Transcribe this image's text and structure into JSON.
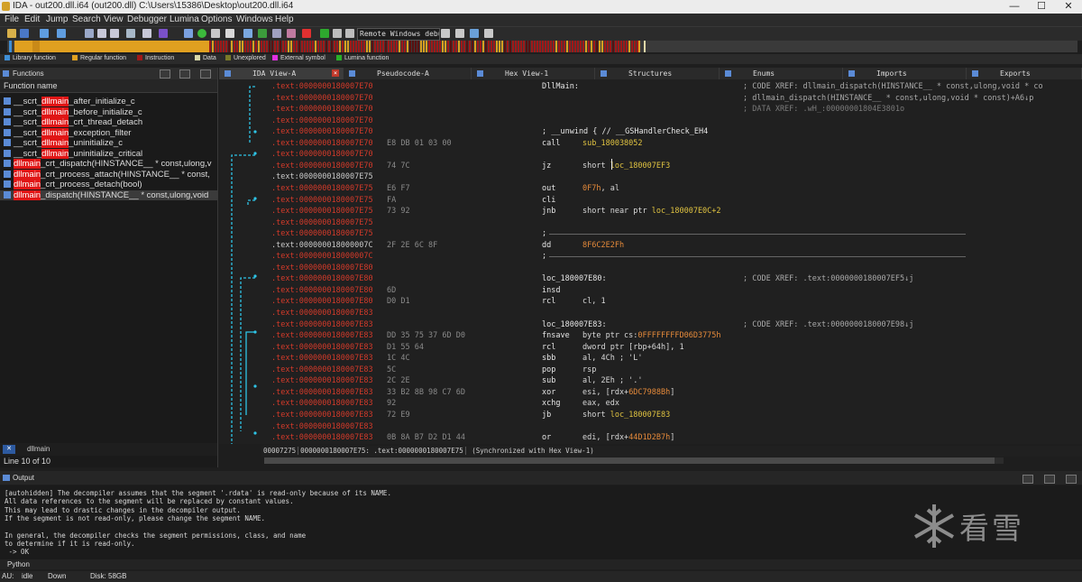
{
  "window": {
    "title": "IDA - out200.dll.i64 (out200.dll) C:\\Users\\15386\\Desktop\\out200.dll.i64",
    "minimize": "—",
    "maximize": "☐",
    "close": "✕"
  },
  "menu": [
    "File",
    "Edit",
    "Jump",
    "Search",
    "View",
    "Debugger",
    "Lumina",
    "Options",
    "Windows",
    "Help"
  ],
  "toolbar": {
    "debugger": "Remote Windows debugger"
  },
  "legend": [
    {
      "label": "Library function",
      "color": "#3f8fd6"
    },
    {
      "label": "Regular function",
      "color": "#e0a020"
    },
    {
      "label": "Instruction",
      "color": "#a01818"
    },
    {
      "label": "Data",
      "color": "#d8d8a8"
    },
    {
      "label": "Unexplored",
      "color": "#7a7a28"
    },
    {
      "label": "External symbol",
      "color": "#e030e0"
    },
    {
      "label": "Lumina function",
      "color": "#28b028"
    }
  ],
  "functions_panel": {
    "title": "Functions",
    "column": "Function name",
    "rows": [
      {
        "pre": "__scrt_",
        "hl": "dllmain",
        "post": "_after_initialize_c",
        "sel": false
      },
      {
        "pre": "__scrt_",
        "hl": "dllmain",
        "post": "_before_initialize_c",
        "sel": false
      },
      {
        "pre": "__scrt_",
        "hl": "dllmain",
        "post": "_crt_thread_detach",
        "sel": false
      },
      {
        "pre": "__scrt_",
        "hl": "dllmain",
        "post": "_exception_filter",
        "sel": false
      },
      {
        "pre": "__scrt_",
        "hl": "dllmain",
        "post": "_uninitialize_c",
        "sel": false
      },
      {
        "pre": "__scrt_",
        "hl": "dllmain",
        "post": "_uninitialize_critical",
        "sel": false
      },
      {
        "pre": "",
        "hl": "dllmain",
        "post": "_crt_dispatch(HINSTANCE__ * const,ulong,v",
        "sel": false
      },
      {
        "pre": "",
        "hl": "dllmain",
        "post": "_crt_process_attach(HINSTANCE__ * const,",
        "sel": false
      },
      {
        "pre": "",
        "hl": "dllmain",
        "post": "_crt_process_detach(bool)",
        "sel": false
      },
      {
        "pre": "",
        "hl": "dllmain",
        "post": "_dispatch(HINSTANCE__ * const,ulong,void",
        "sel": true
      }
    ],
    "search": "dllmain",
    "line_info": "Line 10 of 10"
  },
  "tabs": [
    {
      "label": "IDA View-A",
      "active": true
    },
    {
      "label": "Pseudocode-A",
      "active": false
    },
    {
      "label": "Hex View-1",
      "active": false
    },
    {
      "label": "Structures",
      "active": false
    },
    {
      "label": "Enums",
      "active": false
    },
    {
      "label": "Imports",
      "active": false
    },
    {
      "label": "Exports",
      "active": false
    }
  ],
  "disasm": [
    {
      "addr": ".text:0000000180007E70",
      "bytes": "",
      "ins": "DllMain:",
      "ops": "",
      "cmt": "; CODE XREF: dllmain_dispatch(HINSTANCE__ * const,ulong,void * co",
      "dim": true
    },
    {
      "addr": ".text:0000000180007E70",
      "bytes": "",
      "ins": "",
      "ops": "",
      "cmt": "; dllmain_dispatch(HINSTANCE__ * const,ulong,void * const)+A6↓p",
      "dim": true
    },
    {
      "addr": ".text:0000000180007E70",
      "bytes": "",
      "ins": "",
      "ops": "",
      "cmt": "; DATA XREF: .wH_:00000001804E3801o",
      "dim": true,
      "cmtdim": true
    },
    {
      "addr": ".text:0000000180007E70",
      "bytes": "",
      "ins": "",
      "ops": "",
      "cmt": "",
      "dim": true
    },
    {
      "addr": ".text:0000000180007E70",
      "bytes": "",
      "ins": "; __unwind { // __GSHandlerCheck_EH4",
      "ops": "",
      "cmt": "",
      "dim": true
    },
    {
      "addr": ".text:0000000180007E70",
      "bytes": "E8 DB 01 03 00",
      "ins": "call",
      "ops": "sub_180038052",
      "opsc": "y",
      "cmt": "",
      "dim": true
    },
    {
      "addr": ".text:0000000180007E70",
      "bytes": "",
      "ins": "",
      "ops": "",
      "cmt": "",
      "dim": true
    },
    {
      "addr": ".text:0000000180007E70",
      "bytes": "74 7C",
      "ins": "jz",
      "ops": "short loc_180007EF3",
      "opsy": "loc_180007EF3",
      "cmt": "",
      "dim": true
    },
    {
      "addr": ".text:0000000180007E75",
      "bytes": "",
      "ins": "",
      "ops": "",
      "cmt": "",
      "dim": false
    },
    {
      "addr": ".text:0000000180007E75",
      "bytes": "E6 F7",
      "ins": "out",
      "ops": "0F7h, al",
      "opso": "0F7h",
      "cmt": "",
      "dim": true
    },
    {
      "addr": ".text:0000000180007E75",
      "bytes": "FA",
      "ins": "cli",
      "ops": "",
      "cmt": "",
      "dim": true
    },
    {
      "addr": ".text:0000000180007E75",
      "bytes": "73 92",
      "ins": "jnb",
      "ops": "short near ptr loc_180007E0C+2",
      "opsy": "loc_180007E0C+2",
      "cmt": "",
      "dim": true
    },
    {
      "addr": ".text:0000000180007E75",
      "bytes": "",
      "ins": "",
      "ops": "",
      "cmt": "",
      "dim": true
    },
    {
      "addr": ".text:0000000180007E75",
      "bytes": "",
      "ins": "; ",
      "ops": "",
      "cmt": "",
      "dim": true,
      "sep": true
    },
    {
      "addr": ".text:000000018000007C",
      "bytes": "2F 2E 6C 8F",
      "ins": "dd",
      "ops": "8F6C2E2Fh",
      "opso": "8F6C2E2Fh",
      "cmt": "",
      "dim": false
    },
    {
      "addr": ".text:000000018000007C",
      "bytes": "",
      "ins": "; ",
      "ops": "",
      "cmt": "",
      "dim": true,
      "sep": true
    },
    {
      "addr": ".text:0000000180007E80",
      "bytes": "",
      "ins": "",
      "ops": "",
      "cmt": "",
      "dim": true
    },
    {
      "addr": ".text:0000000180007E80",
      "bytes": "",
      "ins": "loc_180007E80:",
      "ops": "",
      "cmt": "; CODE XREF: .text:0000000180007EF5↓j",
      "dim": true
    },
    {
      "addr": ".text:0000000180007E80",
      "bytes": "6D",
      "ins": "insd",
      "ops": "",
      "cmt": "",
      "dim": true
    },
    {
      "addr": ".text:0000000180007E80",
      "bytes": "D0 D1",
      "ins": "rcl",
      "ops": "cl, 1",
      "cmt": "",
      "dim": true
    },
    {
      "addr": ".text:0000000180007E83",
      "bytes": "",
      "ins": "",
      "ops": "",
      "cmt": "",
      "dim": true
    },
    {
      "addr": ".text:0000000180007E83",
      "bytes": "",
      "ins": "loc_180007E83:",
      "ops": "",
      "cmt": "; CODE XREF: .text:0000000180007E98↓j",
      "dim": true
    },
    {
      "addr": ".text:0000000180007E83",
      "bytes": "DD 35 75 37 6D D0",
      "ins": "fnsave",
      "ops": "byte ptr cs:0FFFFFFFFD06D3775h",
      "opso": "0FFFFFFFFD06D3775h",
      "cmt": "",
      "dim": true
    },
    {
      "addr": ".text:0000000180007E83",
      "bytes": "D1 55 64",
      "ins": "rcl",
      "ops": "dword ptr [rbp+64h], 1",
      "cmt": "",
      "dim": true
    },
    {
      "addr": ".text:0000000180007E83",
      "bytes": "1C 4C",
      "ins": "sbb",
      "ops": "al, 4Ch ; 'L'",
      "cmt": "",
      "dim": true
    },
    {
      "addr": ".text:0000000180007E83",
      "bytes": "5C",
      "ins": "pop",
      "ops": "rsp",
      "cmt": "",
      "dim": true
    },
    {
      "addr": ".text:0000000180007E83",
      "bytes": "2C 2E",
      "ins": "sub",
      "ops": "al, 2Eh ; '.'",
      "cmt": "",
      "dim": true
    },
    {
      "addr": ".text:0000000180007E83",
      "bytes": "33 B2 8B 98 C7 6D",
      "ins": "xor",
      "ops": "esi, [rdx+6DC7988Bh]",
      "opso": "6DC7988Bh",
      "cmt": "",
      "dim": true
    },
    {
      "addr": ".text:0000000180007E83",
      "bytes": "92",
      "ins": "xchg",
      "ops": "eax, edx",
      "cmt": "",
      "dim": true
    },
    {
      "addr": ".text:0000000180007E83",
      "bytes": "72 E9",
      "ins": "jb",
      "ops": "short loc_180007E83",
      "opsy": "loc_180007E83",
      "cmt": "",
      "dim": true
    },
    {
      "addr": ".text:0000000180007E83",
      "bytes": "",
      "ins": "",
      "ops": "",
      "cmt": "",
      "dim": true
    },
    {
      "addr": ".text:0000000180007E83",
      "bytes": "0B 8A B7 D2 D1 44",
      "ins": "or",
      "ops": "edi, [rdx+44D1D2B7h]",
      "opso": "44D1D2B7h",
      "cmt": "",
      "dim": true
    }
  ],
  "sync": {
    "pos": "00007275",
    "addr": "0000000180007E75: .text:0000000180007E75",
    "status": "(Synchronized with Hex View-1)"
  },
  "output": {
    "title": "Output",
    "lines": [
      "[autohidden] The decompiler assumes that the segment '.rdata' is read-only because of its NAME.",
      "All data references to the segment will be replaced by constant values.",
      "This may lead to drastic changes in the decompiler output.",
      "If the segment is not read-only, please change the segment NAME.",
      "",
      "In general, the decompiler checks the segment permissions, class, and name",
      "to determine if it is read-only.",
      " -> OK"
    ],
    "prompt": "Python"
  },
  "status": {
    "au": "AU:",
    "state": "idle",
    "dir": "Down",
    "disk": "Disk: 58GB"
  },
  "watermark": "看雪"
}
